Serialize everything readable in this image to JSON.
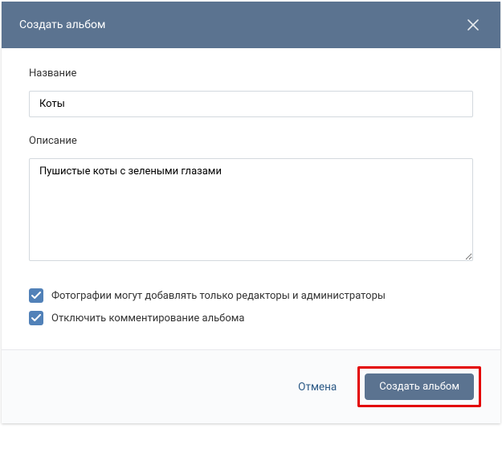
{
  "header": {
    "title": "Создать альбом"
  },
  "fields": {
    "name": {
      "label": "Название",
      "value": "Коты"
    },
    "description": {
      "label": "Описание",
      "value": "Пушистые коты с зелеными глазами"
    }
  },
  "checkboxes": {
    "editors_only": {
      "label": "Фотографии могут добавлять только редакторы и администраторы",
      "checked": true
    },
    "disable_comments": {
      "label": "Отключить комментирование альбома",
      "checked": true
    }
  },
  "footer": {
    "cancel": "Отмена",
    "submit": "Создать альбом"
  }
}
